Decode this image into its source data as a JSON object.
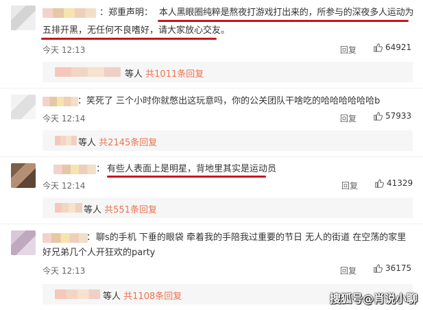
{
  "comments": [
    {
      "name_suffix": "：郑重声明：",
      "lines": [
        "本人黑眼圈纯粹是熬夜打游戏打出来的，所参与的深夜多人运动为",
        "五排开黑，无任何不良嗜好，请大家放心交友。"
      ],
      "time": "今天 12:13",
      "reply_label": "回复",
      "likes": "64921",
      "sub_people": "等人",
      "sub_count": "共1011条回复"
    },
    {
      "name_suffix": "：",
      "lines": [
        "笑死了 三个小时你就憋出这玩意吗，你的公关团队干啥吃的哈哈哈哈哈哈b"
      ],
      "time": "今天 12:14",
      "reply_label": "回复",
      "likes": "57933",
      "sub_people": "等人",
      "sub_count": "共2145条回复"
    },
    {
      "name_suffix": "：",
      "lines": [
        "有些人表面上是明星，背地里其实是运动员"
      ],
      "time": "今天 12:14",
      "reply_label": "回复",
      "likes": "41329",
      "sub_people": "等人",
      "sub_count": "共551条回复"
    },
    {
      "name_suffix": "：",
      "lines": [
        "聊s的手机 下垂的眼袋 牵着我的手陪我过重要的节日 无人的街道 在空荡的家里",
        "好兄弟几个人开狂欢的party"
      ],
      "time": "今天 12:13",
      "reply_label": "回复",
      "likes": "36175",
      "sub_people": "等人",
      "sub_count": "共1108条回复"
    }
  ],
  "watermark": "搜狐号@肖说小聊",
  "colors": {
    "accent": "#eb7350",
    "underline": "#c9141b",
    "sub_bg": "#f6f6f6"
  }
}
